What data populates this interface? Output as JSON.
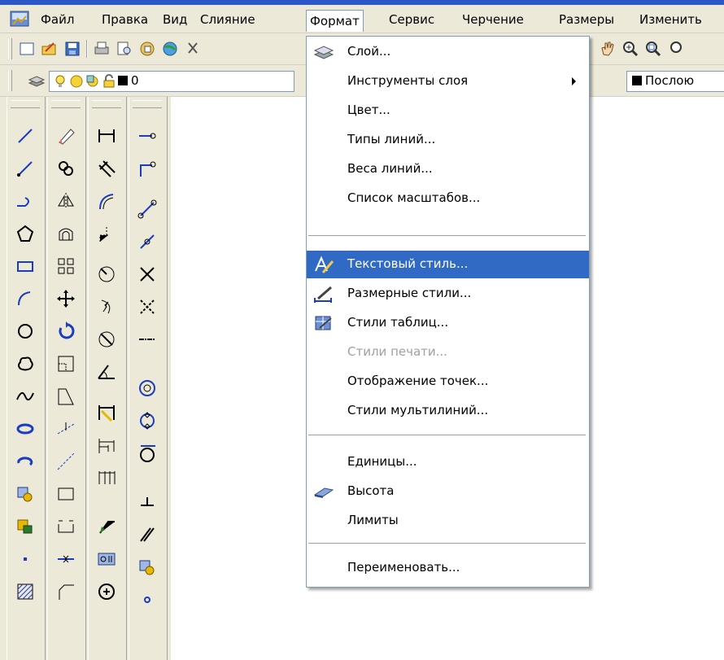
{
  "menubar": {
    "items": [
      "Файл",
      "Правка",
      "Вид",
      "Слияние",
      "Формат",
      "Сервис",
      "Черчение",
      "Размеры",
      "Изменить"
    ]
  },
  "layer_toolbar": {
    "layer_value": "0"
  },
  "props_toolbar": {
    "linetype_value": "Послою"
  },
  "format_menu": {
    "items": [
      {
        "label": "Слой...",
        "icon": "layers-icon"
      },
      {
        "label": "Инструменты слоя",
        "submenu": true
      },
      {
        "label": "Цвет..."
      },
      {
        "label": "Типы линий..."
      },
      {
        "label": "Веса линий..."
      },
      {
        "label": "Список масштабов..."
      },
      {
        "label": "Текстовый стиль...",
        "icon": "text-style-icon",
        "state": "highlighted"
      },
      {
        "label": "Размерные стили...",
        "icon": "dimension-style-icon"
      },
      {
        "label": "Стили таблиц...",
        "icon": "table-style-icon"
      },
      {
        "label": "Стили печати...",
        "state": "disabled"
      },
      {
        "label": "Отображение точек..."
      },
      {
        "label": "Стили мультилиний..."
      },
      {
        "label": "Единицы..."
      },
      {
        "label": "Высота",
        "icon": "thickness-icon"
      },
      {
        "label": "Лимиты"
      },
      {
        "label": "Переименовать..."
      }
    ]
  },
  "colors": {
    "highlight": "#316ac5",
    "menu_border": "#7f9db9",
    "chrome": "#ece9d8",
    "title_blue": "#2b57c7"
  }
}
